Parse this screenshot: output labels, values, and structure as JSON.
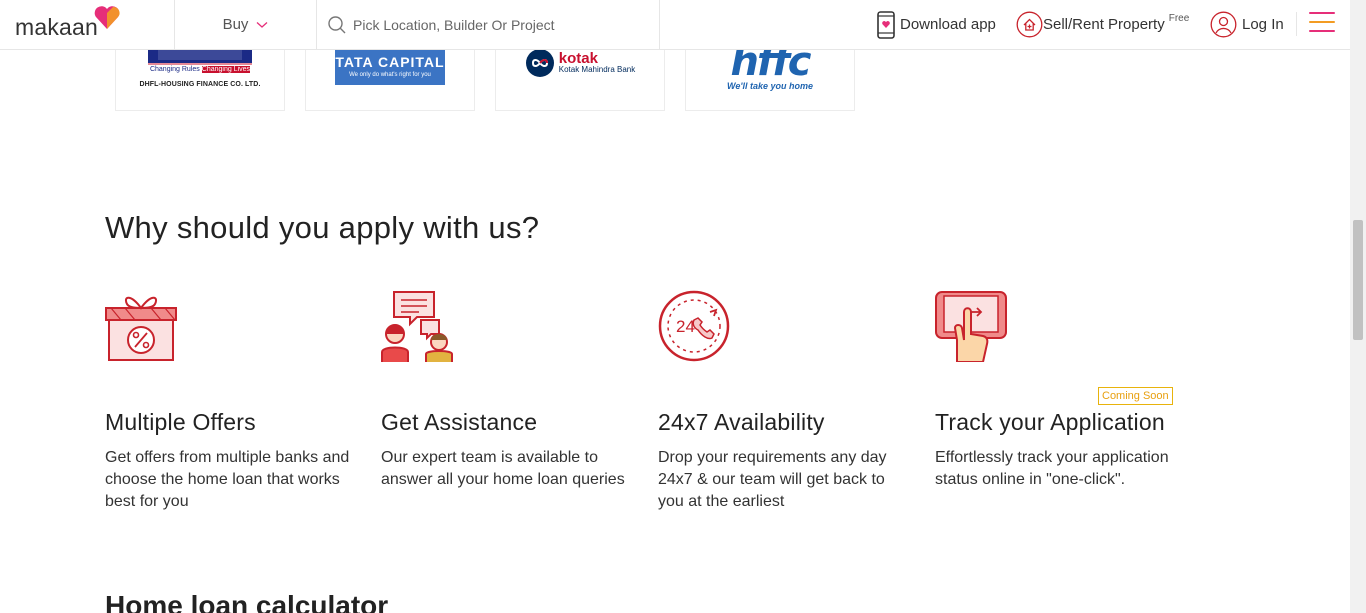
{
  "header": {
    "logo_text": "makaan",
    "buy_label": "Buy",
    "search_placeholder": "Pick Location, Builder Or Project",
    "download_label": "Download app",
    "sell_label": "Sell/Rent Property",
    "sell_badge": "Free",
    "login_label": "Log In",
    "menu_colors": [
      "#e62e79",
      "#f39c23",
      "#e62e79"
    ]
  },
  "banks": [
    {
      "name_line": "DHFL-HOUSING FINANCE CO. LTD.",
      "tagline_a": "Changing Rules",
      "tagline_b": "Changing Lives"
    },
    {
      "name": "TATA CAPITAL",
      "tagline": "We only do what's right for you"
    },
    {
      "name": "kotak",
      "sub": "Kotak Mahindra Bank"
    },
    {
      "name": "hffc",
      "tagline": "We'll take you home"
    }
  ],
  "why": {
    "title": "Why should you apply with us?",
    "features": [
      {
        "title": "Multiple Offers",
        "desc": "Get offers from multiple banks and choose the home loan that works best for you",
        "icon": "gift-percent-icon"
      },
      {
        "title": "Get Assistance",
        "desc": "Our expert team is available to answer all your home loan queries",
        "icon": "assistance-chat-icon"
      },
      {
        "title": "24x7 Availability",
        "desc": "Drop your requirements any day 24x7 & our team will get back to you at the earliest",
        "icon": "clock-24x7-icon"
      },
      {
        "title": "Track your Application",
        "desc": "Effortlessly track your application status online in \"one-click\".",
        "icon": "track-tap-icon",
        "badge": "Coming Soon"
      }
    ]
  },
  "calculator": {
    "title": "Home loan calculator"
  },
  "colors": {
    "accent": "#e62e79",
    "icon_red": "#c8232c",
    "icon_light": "#f6c9c9",
    "badge": "#e8a010"
  }
}
